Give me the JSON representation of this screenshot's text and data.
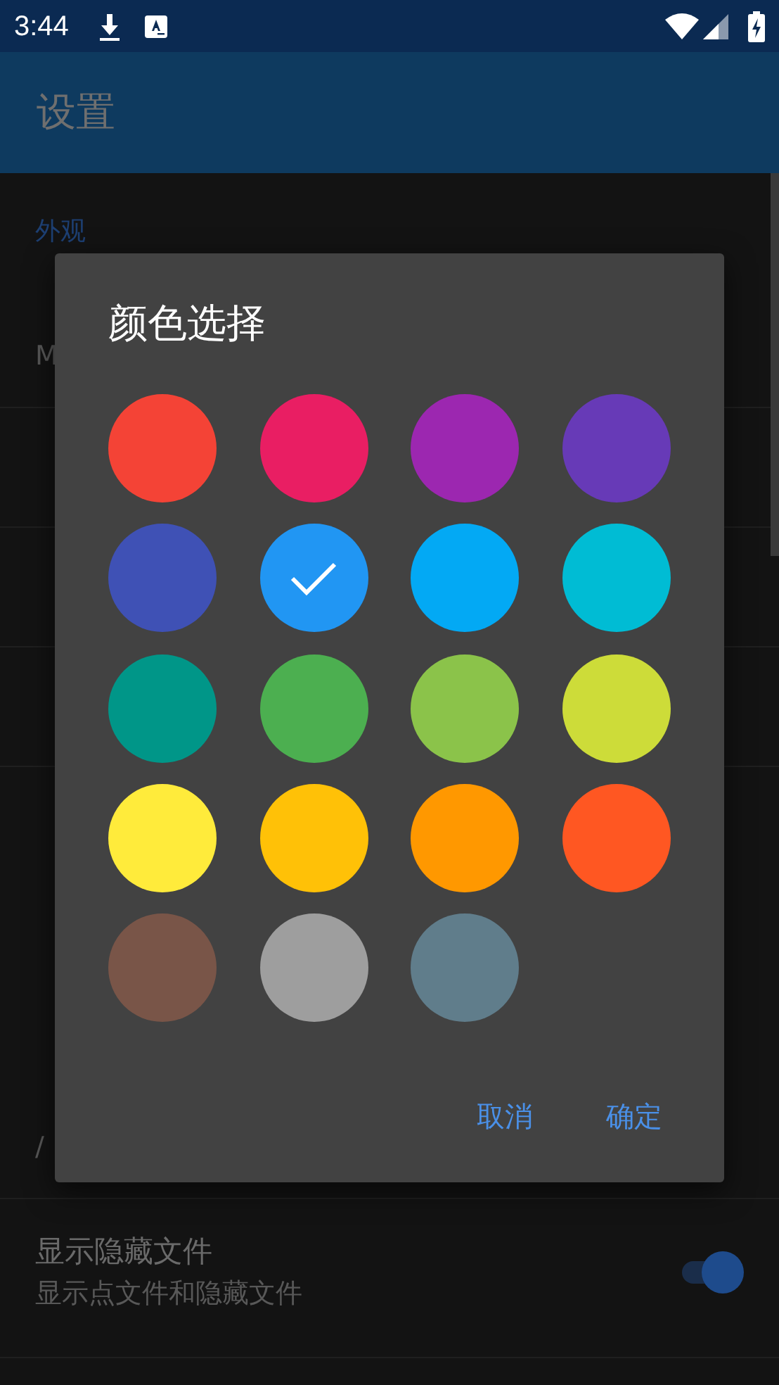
{
  "status_bar": {
    "time": "3:44"
  },
  "app_bar": {
    "title": "设置"
  },
  "settings": [
    {
      "kind": "header",
      "title": "外观"
    },
    {
      "kind": "item",
      "subtitle": "M"
    },
    {
      "kind": "item"
    },
    {
      "kind": "item"
    },
    {
      "kind": "item"
    },
    {
      "kind": "header"
    },
    {
      "kind": "item",
      "subtitle": "/"
    },
    {
      "kind": "toggle",
      "title": "显示隐藏文件",
      "subtitle": "显示点文件和隐藏文件",
      "on": true
    }
  ],
  "dialog": {
    "title": "颜色选择",
    "colors": [
      {
        "color": "#f44336",
        "selected": false
      },
      {
        "color": "#e91e63",
        "selected": false
      },
      {
        "color": "#9c27b0",
        "selected": false
      },
      {
        "color": "#673ab7",
        "selected": false
      },
      {
        "color": "#3f51b5",
        "selected": false
      },
      {
        "color": "#2196f3",
        "selected": true
      },
      {
        "color": "#03a9f4",
        "selected": false
      },
      {
        "color": "#00bcd4",
        "selected": false
      },
      {
        "color": "#009688",
        "selected": false
      },
      {
        "color": "#4caf50",
        "selected": false
      },
      {
        "color": "#8bc34a",
        "selected": false
      },
      {
        "color": "#cddc39",
        "selected": false
      },
      {
        "color": "#ffeb3b",
        "selected": false
      },
      {
        "color": "#ffc107",
        "selected": false
      },
      {
        "color": "#ff9800",
        "selected": false
      },
      {
        "color": "#ff5722",
        "selected": false
      },
      {
        "color": "#795548",
        "selected": false
      },
      {
        "color": "#9e9e9e",
        "selected": false
      },
      {
        "color": "#607d8b",
        "selected": false
      }
    ],
    "buttons": [
      "取消",
      "确定"
    ]
  }
}
